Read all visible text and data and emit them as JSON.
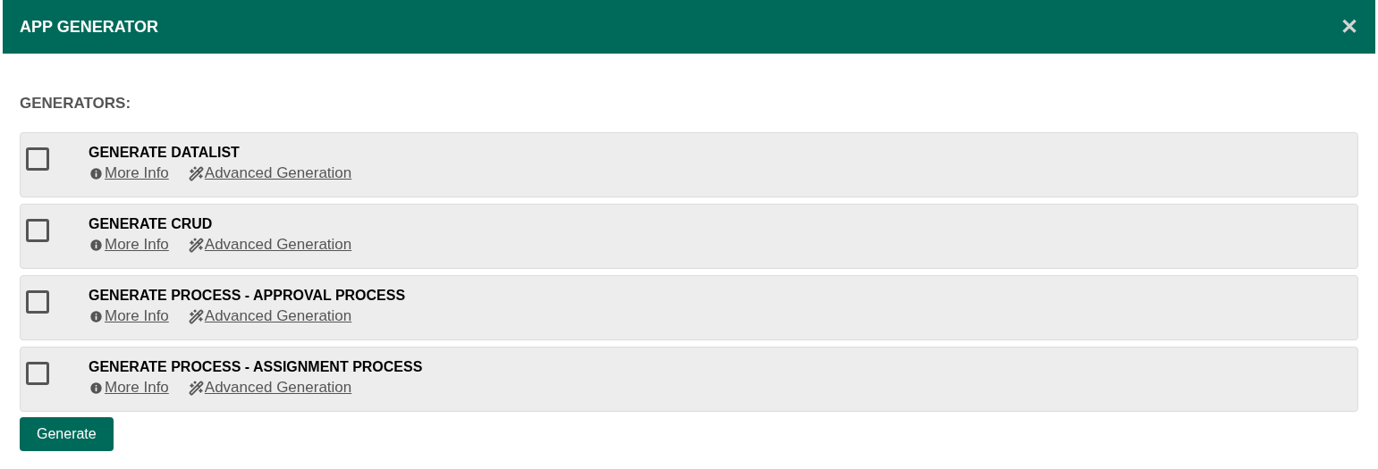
{
  "dialog": {
    "title": "APP GENERATOR",
    "close": "✕"
  },
  "section_title": "GENERATORS:",
  "generators": [
    {
      "name": "GENERATE DATALIST",
      "checked": false,
      "links": [
        "More Info",
        "Advanced Generation"
      ]
    },
    {
      "name": "GENERATE CRUD",
      "checked": false,
      "links": [
        "More Info",
        "Advanced Generation"
      ]
    },
    {
      "name": "GENERATE PROCESS - APPROVAL PROCESS",
      "checked": false,
      "links": [
        "More Info",
        "Advanced Generation"
      ]
    },
    {
      "name": "GENERATE PROCESS - ASSIGNMENT PROCESS",
      "checked": false,
      "links": [
        "More Info",
        "Advanced Generation"
      ]
    }
  ],
  "button": "Generate"
}
